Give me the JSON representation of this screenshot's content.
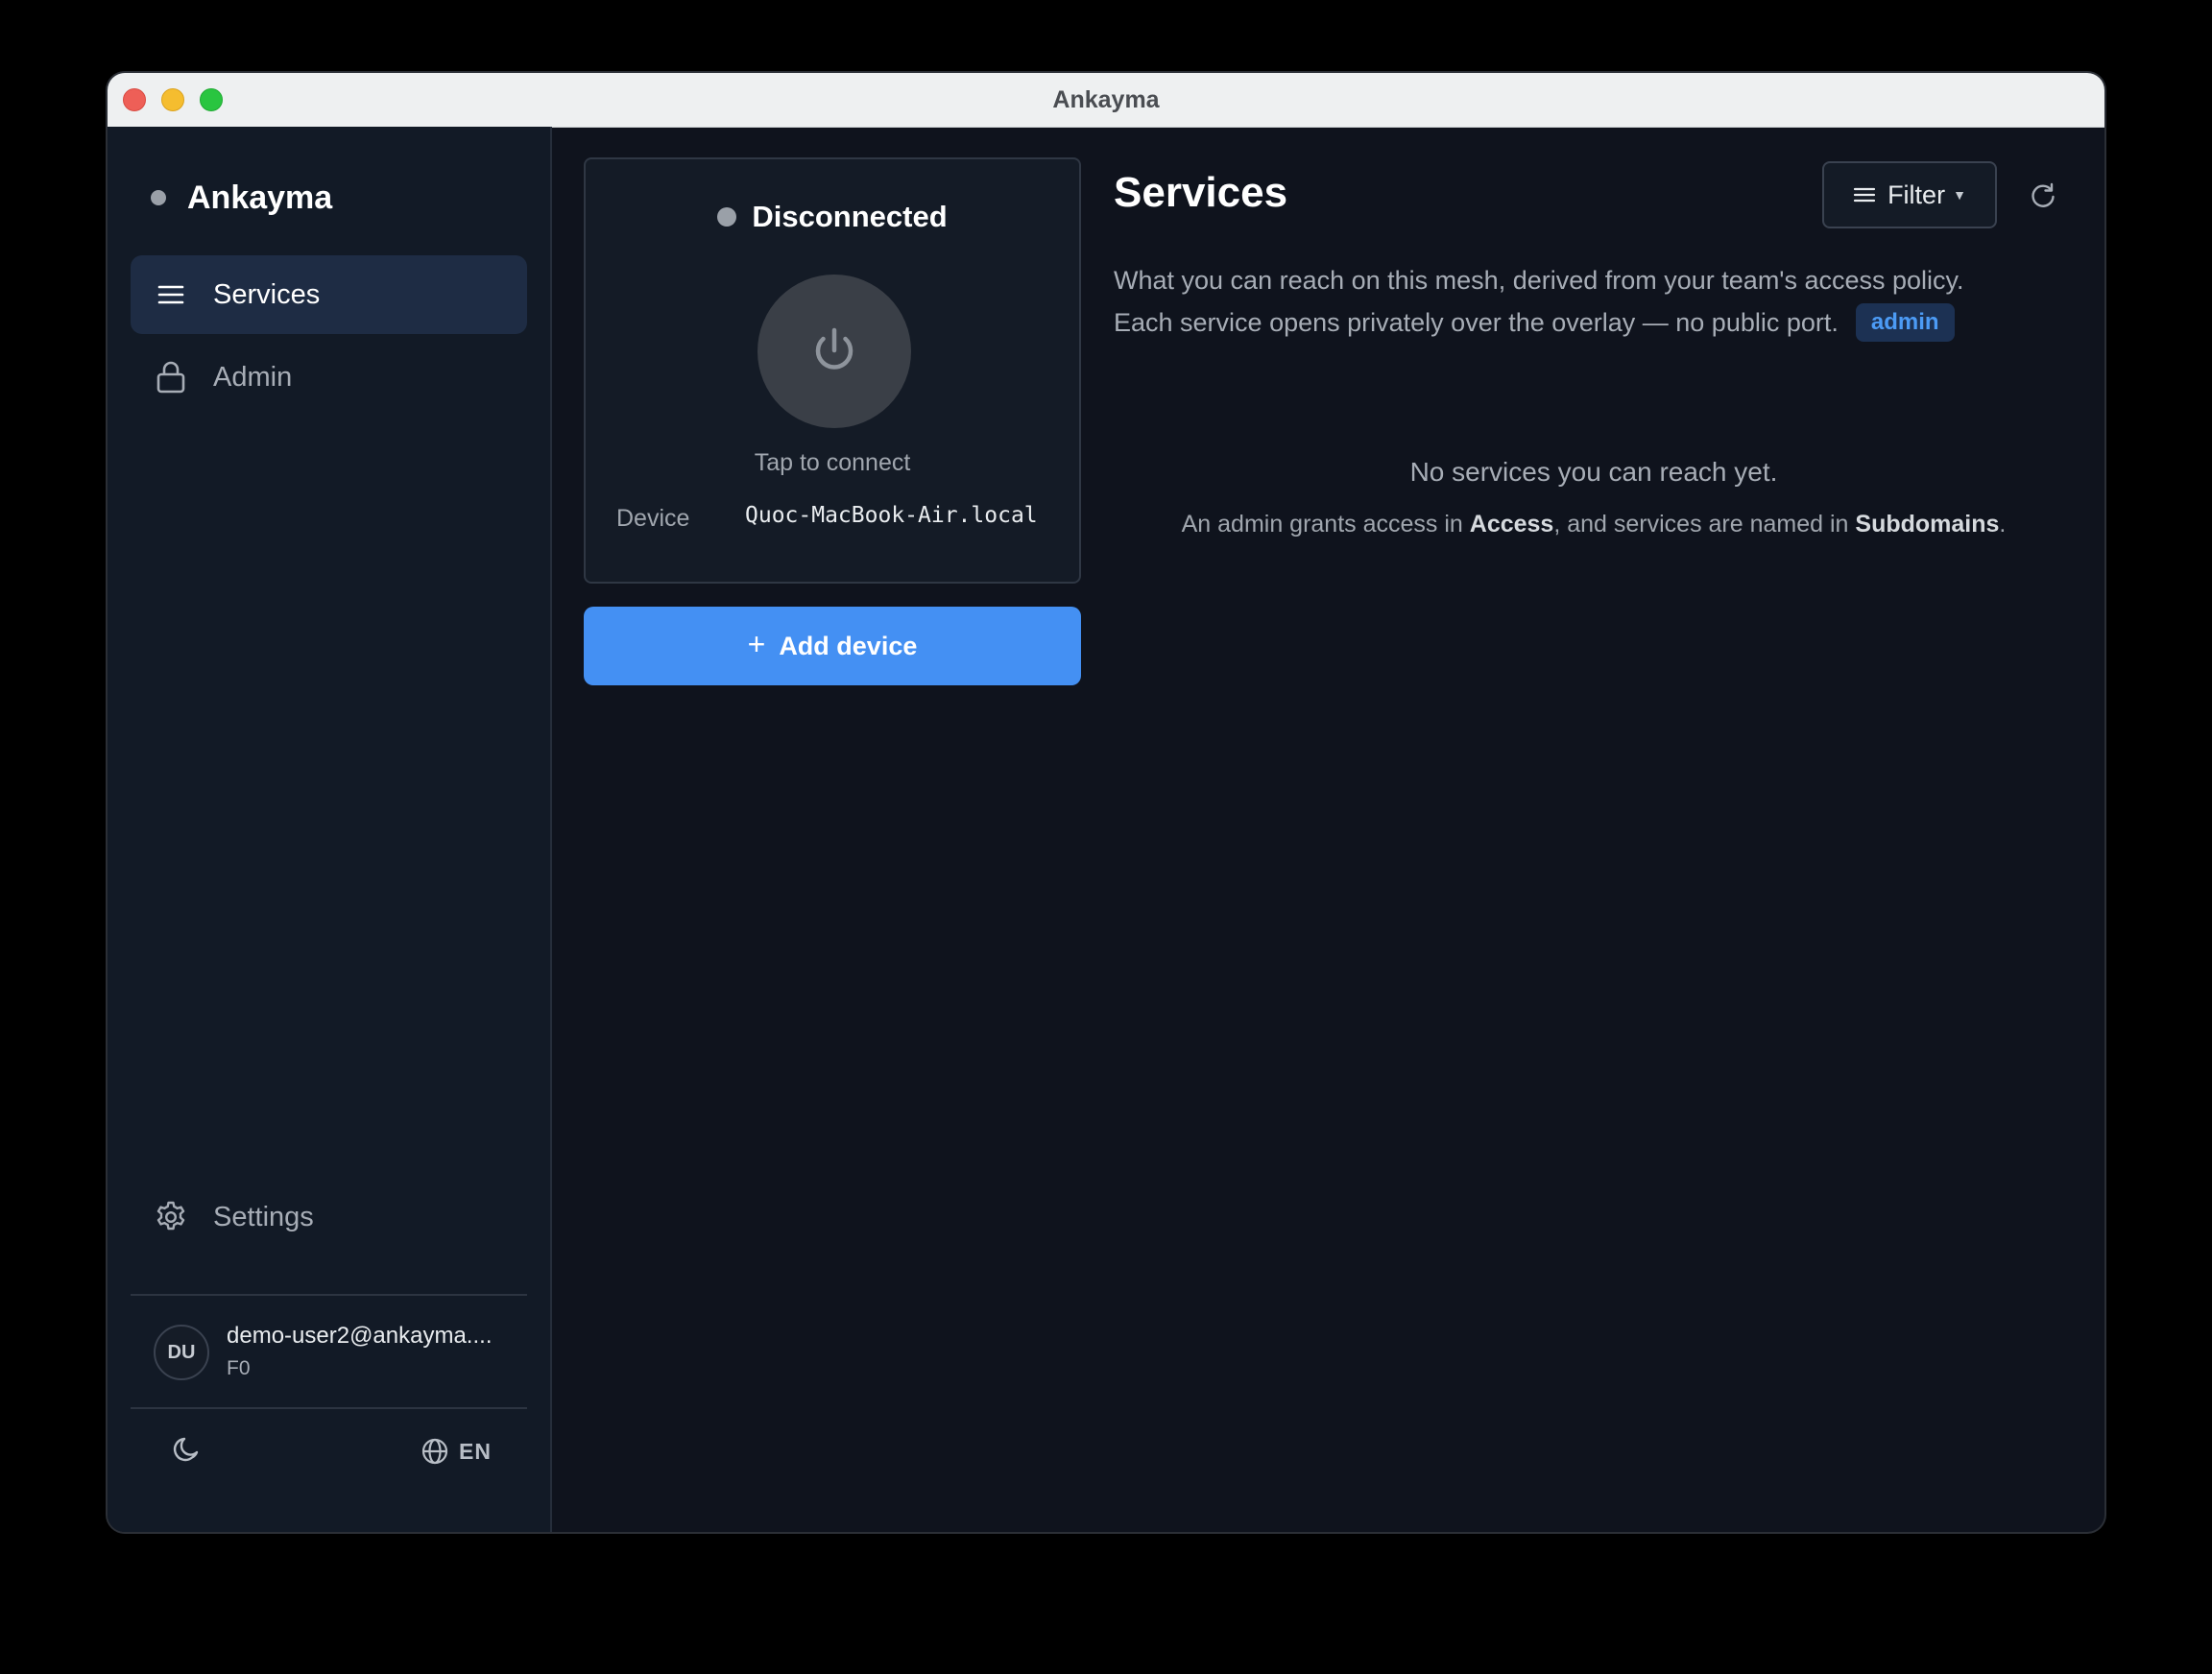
{
  "window": {
    "title": "Ankayma"
  },
  "sidebar": {
    "brand": "Ankayma",
    "items": [
      {
        "label": "Services",
        "icon": "list-icon",
        "active": true
      },
      {
        "label": "Admin",
        "icon": "lock-icon",
        "active": false
      }
    ],
    "settings_label": "Settings",
    "user": {
      "initials": "DU",
      "email": "demo-user2@ankayma....",
      "sub": "F0"
    },
    "language": "EN"
  },
  "connection": {
    "status": "Disconnected",
    "tap_label": "Tap to connect",
    "device_label": "Device",
    "device_value": "Quoc-MacBook-Air.local",
    "add_device_label": "Add device"
  },
  "services": {
    "title": "Services",
    "filter_label": "Filter",
    "description_line1": "What you can reach on this mesh, derived from your team's access policy.",
    "description_line2": "Each service opens privately over the overlay — no public port.",
    "role_badge": "admin",
    "empty_title": "No services you can reach yet.",
    "empty_sub_part1": "An admin grants access in ",
    "empty_sub_access": "Access",
    "empty_sub_part2": ", and services are named in ",
    "empty_sub_subdomains": "Subdomains",
    "empty_sub_part3": "."
  },
  "colors": {
    "accent": "#4490f3",
    "sidebar_active": "#1e2c44",
    "background": "#0f131d",
    "status_disconnected": "#9aa0a8"
  }
}
